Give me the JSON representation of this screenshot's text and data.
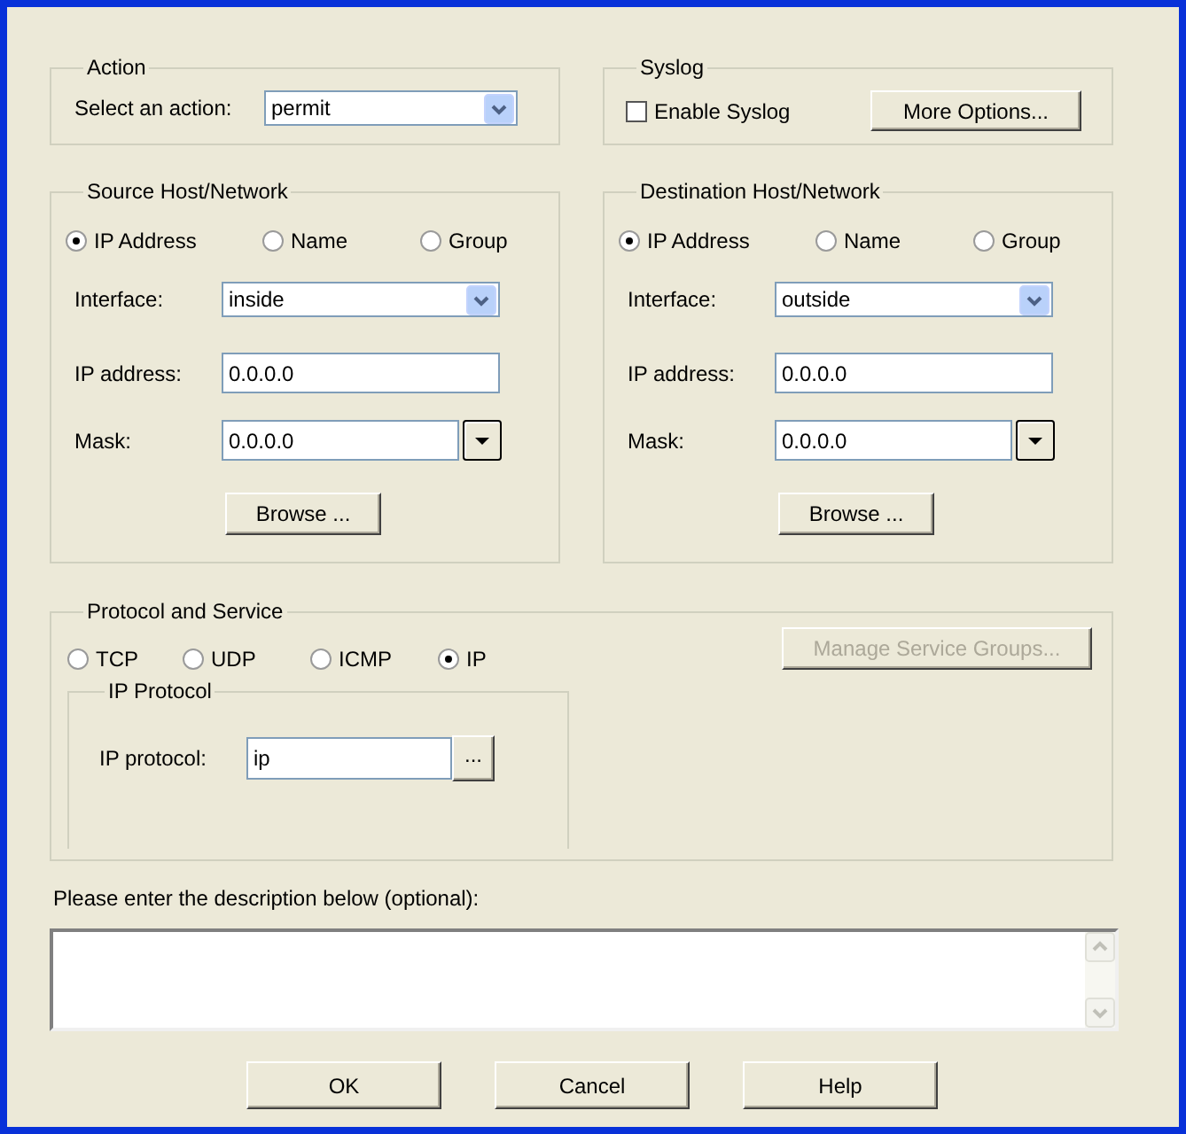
{
  "action": {
    "title": "Action",
    "label": "Select an action:",
    "value": "permit"
  },
  "syslog": {
    "title": "Syslog",
    "checkbox": {
      "label": "Enable Syslog",
      "checked": false
    },
    "button": "More Options..."
  },
  "hosts": [
    {
      "title": "Source Host/Network",
      "modes": [
        {
          "label": "IP Address",
          "selected": true
        },
        {
          "label": "Name",
          "selected": false
        },
        {
          "label": "Group",
          "selected": false
        }
      ],
      "interface": {
        "label": "Interface:",
        "value": "inside"
      },
      "ip_address": {
        "label": "IP address:",
        "value": "0.0.0.0"
      },
      "mask": {
        "label": "Mask:",
        "value": "0.0.0.0"
      },
      "button": "Browse ..."
    },
    {
      "title": "Destination Host/Network",
      "modes": [
        {
          "label": "IP Address",
          "selected": true
        },
        {
          "label": "Name",
          "selected": false
        },
        {
          "label": "Group",
          "selected": false
        }
      ],
      "interface": {
        "label": "Interface:",
        "value": "outside"
      },
      "ip_address": {
        "label": "IP address:",
        "value": "0.0.0.0"
      },
      "mask": {
        "label": "Mask:",
        "value": "0.0.0.0"
      },
      "button": "Browse ..."
    }
  ],
  "protocol": {
    "title": "Protocol and Service",
    "types": [
      {
        "label": "TCP",
        "selected": false
      },
      {
        "label": "UDP",
        "selected": false
      },
      {
        "label": "ICMP",
        "selected": false
      },
      {
        "label": "IP",
        "selected": true
      }
    ],
    "manage_button": {
      "label": "Manage Service Groups...",
      "disabled": true
    },
    "ip_protocol": {
      "title": "IP Protocol",
      "label": "IP protocol:",
      "value": "ip",
      "button": "..."
    }
  },
  "description": {
    "label": "Please enter the description below (optional):"
  },
  "buttons": [
    "OK",
    "Cancel",
    "Help"
  ]
}
